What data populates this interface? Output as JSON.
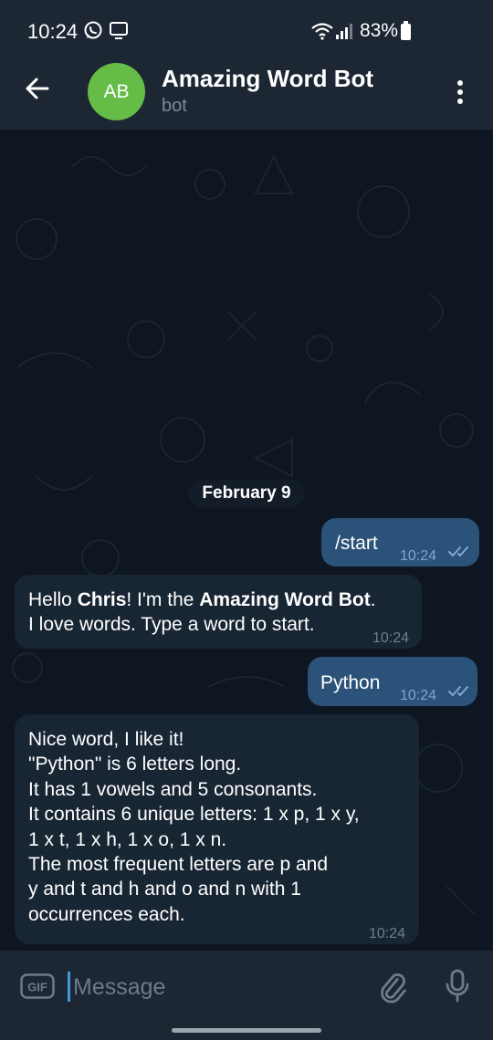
{
  "status_bar": {
    "time": "10:24",
    "battery": "83%",
    "icons": [
      "whatsapp-icon",
      "cast-icon",
      "wifi-icon",
      "signal-icon",
      "battery-icon"
    ]
  },
  "app_bar": {
    "avatar_initials": "AB",
    "title": "Amazing Word Bot",
    "subtitle": "bot",
    "icons": [
      "back-arrow-icon",
      "more-vertical-icon"
    ]
  },
  "chat": {
    "date_separator": "February 9",
    "messages": [
      {
        "direction": "out",
        "text": "/start",
        "time": "10:24",
        "status": "read"
      },
      {
        "direction": "in",
        "parts": [
          "Hello ",
          "Chris",
          "! I'm the ",
          "Amazing Word Bot",
          "."
        ],
        "line2": "I love words. Type a word to start.",
        "time": "10:24"
      },
      {
        "direction": "out",
        "text": "Python",
        "time": "10:24",
        "status": "read"
      },
      {
        "direction": "in",
        "lines": [
          "Nice word, I like it!",
          "\"Python\" is 6 letters long.",
          "It has 1 vowels and 5 consonants.",
          "It contains 6 unique letters: 1 x p, 1 x y,",
          "1 x t, 1 x h, 1 x o, 1 x n.",
          "The most frequent letters are p and",
          "y and t and h and o and n with 1",
          "occurrences each."
        ],
        "time": "10:24"
      }
    ]
  },
  "input_bar": {
    "placeholder": "Message",
    "gif_label": "GIF",
    "icons": [
      "gif-icon",
      "attach-icon",
      "mic-icon"
    ]
  },
  "colors": {
    "background": "#0e1621",
    "header": "#1c2733",
    "outgoing_bubble": "#2b5278",
    "incoming_bubble": "#182533",
    "avatar": "#65bc46",
    "accent": "#3f9be0"
  }
}
